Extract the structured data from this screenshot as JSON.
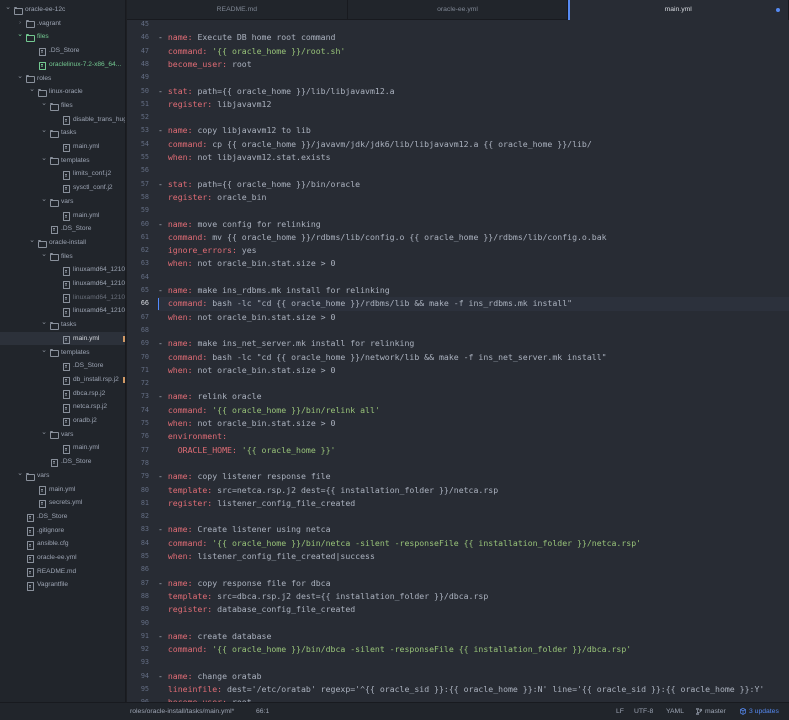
{
  "sidebar": {
    "items": [
      {
        "label": "oracle-ee-12c",
        "kind": "folder",
        "depth": 0,
        "expanded": true
      },
      {
        "label": ".vagrant",
        "kind": "folder",
        "depth": 1,
        "expanded": false
      },
      {
        "label": "files",
        "kind": "folder",
        "depth": 1,
        "expanded": true,
        "status": "added"
      },
      {
        "label": ".DS_Store",
        "kind": "file",
        "depth": 2
      },
      {
        "label": "oraclelinux-7.2-x86_64...",
        "kind": "file",
        "depth": 2,
        "status": "added"
      },
      {
        "label": "roles",
        "kind": "folder",
        "depth": 1,
        "expanded": true
      },
      {
        "label": "linux-oracle",
        "kind": "folder",
        "depth": 2,
        "expanded": true
      },
      {
        "label": "files",
        "kind": "folder",
        "depth": 3,
        "expanded": true
      },
      {
        "label": "disable_trans_hug...",
        "kind": "file",
        "depth": 4
      },
      {
        "label": "tasks",
        "kind": "folder",
        "depth": 3,
        "expanded": true
      },
      {
        "label": "main.yml",
        "kind": "file",
        "depth": 4
      },
      {
        "label": "templates",
        "kind": "folder",
        "depth": 3,
        "expanded": true
      },
      {
        "label": "limits_conf.j2",
        "kind": "file",
        "depth": 4
      },
      {
        "label": "sysctl_conf.j2",
        "kind": "file",
        "depth": 4
      },
      {
        "label": "vars",
        "kind": "folder",
        "depth": 3,
        "expanded": true
      },
      {
        "label": "main.yml",
        "kind": "file",
        "depth": 4
      },
      {
        "label": ".DS_Store",
        "kind": "file",
        "depth": 3
      },
      {
        "label": "oracle-install",
        "kind": "folder",
        "depth": 2,
        "expanded": true
      },
      {
        "label": "files",
        "kind": "folder",
        "depth": 3,
        "expanded": true
      },
      {
        "label": "linuxamd64_1210...",
        "kind": "file",
        "depth": 4
      },
      {
        "label": "linuxamd64_1210...",
        "kind": "file",
        "depth": 4
      },
      {
        "label": "linuxamd64_1210...",
        "kind": "file",
        "depth": 4,
        "status": "ignored"
      },
      {
        "label": "linuxamd64_1210...",
        "kind": "file",
        "depth": 4
      },
      {
        "label": "tasks",
        "kind": "folder",
        "depth": 3,
        "expanded": true
      },
      {
        "label": "main.yml",
        "kind": "file",
        "depth": 4,
        "selected": true,
        "modified": true
      },
      {
        "label": "templates",
        "kind": "folder",
        "depth": 3,
        "expanded": true
      },
      {
        "label": ".DS_Store",
        "kind": "file",
        "depth": 4
      },
      {
        "label": "db_install.rsp.j2",
        "kind": "file",
        "depth": 4,
        "modified": true
      },
      {
        "label": "dbca.rsp.j2",
        "kind": "file",
        "depth": 4
      },
      {
        "label": "netca.rsp.j2",
        "kind": "file",
        "depth": 4
      },
      {
        "label": "oradb.j2",
        "kind": "file",
        "depth": 4
      },
      {
        "label": "vars",
        "kind": "folder",
        "depth": 3,
        "expanded": true
      },
      {
        "label": "main.yml",
        "kind": "file",
        "depth": 4
      },
      {
        "label": ".DS_Store",
        "kind": "file",
        "depth": 3
      },
      {
        "label": "vars",
        "kind": "folder",
        "depth": 1,
        "expanded": true
      },
      {
        "label": "main.yml",
        "kind": "file",
        "depth": 2
      },
      {
        "label": "secrets.yml",
        "kind": "file",
        "depth": 2
      },
      {
        "label": ".DS_Store",
        "kind": "file",
        "depth": 1
      },
      {
        "label": ".gitignore",
        "kind": "file",
        "depth": 1
      },
      {
        "label": "ansible.cfg",
        "kind": "file",
        "depth": 1
      },
      {
        "label": "oracle-ee.yml",
        "kind": "file",
        "depth": 1
      },
      {
        "label": "README.md",
        "kind": "file",
        "depth": 1
      },
      {
        "label": "Vagrantfile",
        "kind": "file",
        "depth": 1
      }
    ]
  },
  "tabs": [
    {
      "label": "README.md",
      "active": false,
      "modified": false
    },
    {
      "label": "oracle-ee.yml",
      "active": false,
      "modified": false
    },
    {
      "label": "main.yml",
      "active": true,
      "modified": true
    }
  ],
  "editor": {
    "first_line_number": 45,
    "cursor_line": 66,
    "lines": [
      [],
      [
        [
          "dash",
          "- "
        ],
        [
          "key",
          "name:"
        ],
        [
          "val",
          " Execute DB home root command"
        ]
      ],
      [
        [
          "dash",
          "  "
        ],
        [
          "key",
          "command:"
        ],
        [
          "str",
          " '{{ oracle_home }}/root.sh'"
        ]
      ],
      [
        [
          "dash",
          "  "
        ],
        [
          "key",
          "become_user:"
        ],
        [
          "val",
          " root"
        ]
      ],
      [],
      [
        [
          "dash",
          "- "
        ],
        [
          "key",
          "stat:"
        ],
        [
          "val",
          " path={{ oracle_home }}/lib/libjavavm12.a"
        ]
      ],
      [
        [
          "dash",
          "  "
        ],
        [
          "key",
          "register:"
        ],
        [
          "val",
          " libjavavm12"
        ]
      ],
      [],
      [
        [
          "dash",
          "- "
        ],
        [
          "key",
          "name:"
        ],
        [
          "val",
          " copy libjavavm12 to lib"
        ]
      ],
      [
        [
          "dash",
          "  "
        ],
        [
          "key",
          "command:"
        ],
        [
          "val",
          " cp {{ oracle_home }}/javavm/jdk/jdk6/lib/libjavavm12.a {{ oracle_home }}/lib/"
        ]
      ],
      [
        [
          "dash",
          "  "
        ],
        [
          "key",
          "when:"
        ],
        [
          "val",
          " not libjavavm12.stat.exists"
        ]
      ],
      [],
      [
        [
          "dash",
          "- "
        ],
        [
          "key",
          "stat:"
        ],
        [
          "val",
          " path={{ oracle_home }}/bin/oracle"
        ]
      ],
      [
        [
          "dash",
          "  "
        ],
        [
          "key",
          "register:"
        ],
        [
          "val",
          " oracle_bin"
        ]
      ],
      [],
      [
        [
          "dash",
          "- "
        ],
        [
          "key",
          "name:"
        ],
        [
          "val",
          " move config for relinking"
        ]
      ],
      [
        [
          "dash",
          "  "
        ],
        [
          "key",
          "command:"
        ],
        [
          "val",
          " mv {{ oracle_home }}/rdbms/lib/config.o {{ oracle_home }}/rdbms/lib/config.o.bak"
        ]
      ],
      [
        [
          "dash",
          "  "
        ],
        [
          "key",
          "ignore_errors:"
        ],
        [
          "val",
          " yes"
        ]
      ],
      [
        [
          "dash",
          "  "
        ],
        [
          "key",
          "when:"
        ],
        [
          "val",
          " not oracle_bin.stat.size > 0"
        ]
      ],
      [],
      [
        [
          "dash",
          "- "
        ],
        [
          "key",
          "name:"
        ],
        [
          "val",
          " make ins_rdbms.mk install for relinking"
        ]
      ],
      [
        [
          "dash",
          "  "
        ],
        [
          "key",
          "command:"
        ],
        [
          "val",
          " bash -lc \"cd {{ oracle_home }}/rdbms/lib && make -f ins_rdbms.mk install\""
        ]
      ],
      [
        [
          "dash",
          "  "
        ],
        [
          "key",
          "when:"
        ],
        [
          "val",
          " not oracle_bin.stat.size > 0"
        ]
      ],
      [],
      [
        [
          "dash",
          "- "
        ],
        [
          "key",
          "name:"
        ],
        [
          "val",
          " make ins_net_server.mk install for relinking"
        ]
      ],
      [
        [
          "dash",
          "  "
        ],
        [
          "key",
          "command:"
        ],
        [
          "val",
          " bash -lc \"cd {{ oracle_home }}/network/lib && make -f ins_net_server.mk install\""
        ]
      ],
      [
        [
          "dash",
          "  "
        ],
        [
          "key",
          "when:"
        ],
        [
          "val",
          " not oracle_bin.stat.size > 0"
        ]
      ],
      [],
      [
        [
          "dash",
          "- "
        ],
        [
          "key",
          "name:"
        ],
        [
          "val",
          " relink oracle"
        ]
      ],
      [
        [
          "dash",
          "  "
        ],
        [
          "key",
          "command:"
        ],
        [
          "str",
          " '{{ oracle_home }}/bin/relink all'"
        ]
      ],
      [
        [
          "dash",
          "  "
        ],
        [
          "key",
          "when:"
        ],
        [
          "val",
          " not oracle_bin.stat.size > 0"
        ]
      ],
      [
        [
          "dash",
          "  "
        ],
        [
          "key",
          "environment:"
        ]
      ],
      [
        [
          "dash",
          "    "
        ],
        [
          "key",
          "ORACLE_HOME:"
        ],
        [
          "str",
          " '{{ oracle_home }}'"
        ]
      ],
      [],
      [
        [
          "dash",
          "- "
        ],
        [
          "key",
          "name:"
        ],
        [
          "val",
          " copy listener response file"
        ]
      ],
      [
        [
          "dash",
          "  "
        ],
        [
          "key",
          "template:"
        ],
        [
          "val",
          " src=netca.rsp.j2 dest={{ installation_folder }}/netca.rsp"
        ]
      ],
      [
        [
          "dash",
          "  "
        ],
        [
          "key",
          "register:"
        ],
        [
          "val",
          " listener_config_file_created"
        ]
      ],
      [],
      [
        [
          "dash",
          "- "
        ],
        [
          "key",
          "name:"
        ],
        [
          "val",
          " Create listener using netca"
        ]
      ],
      [
        [
          "dash",
          "  "
        ],
        [
          "key",
          "command:"
        ],
        [
          "str",
          " '{{ oracle_home }}/bin/netca -silent -responseFile {{ installation_folder }}/netca.rsp'"
        ]
      ],
      [
        [
          "dash",
          "  "
        ],
        [
          "key",
          "when:"
        ],
        [
          "val",
          " listener_config_file_created|success"
        ]
      ],
      [],
      [
        [
          "dash",
          "- "
        ],
        [
          "key",
          "name:"
        ],
        [
          "val",
          " copy response file for dbca"
        ]
      ],
      [
        [
          "dash",
          "  "
        ],
        [
          "key",
          "template:"
        ],
        [
          "val",
          " src=dbca.rsp.j2 dest={{ installation_folder }}/dbca.rsp"
        ]
      ],
      [
        [
          "dash",
          "  "
        ],
        [
          "key",
          "register:"
        ],
        [
          "val",
          " database_config_file_created"
        ]
      ],
      [],
      [
        [
          "dash",
          "- "
        ],
        [
          "key",
          "name:"
        ],
        [
          "val",
          " create database"
        ]
      ],
      [
        [
          "dash",
          "  "
        ],
        [
          "key",
          "command:"
        ],
        [
          "str",
          " '{{ oracle_home }}/bin/dbca -silent -responseFile {{ installation_folder }}/dbca.rsp'"
        ]
      ],
      [],
      [
        [
          "dash",
          "- "
        ],
        [
          "key",
          "name:"
        ],
        [
          "val",
          " change oratab"
        ]
      ],
      [
        [
          "dash",
          "  "
        ],
        [
          "key",
          "lineinfile:"
        ],
        [
          "val",
          " dest='/etc/oratab' regexp='^{{ oracle_sid }}:{{ oracle_home }}:N' line='{{ oracle_sid }}:{{ oracle_home }}:Y'"
        ]
      ],
      [
        [
          "dash",
          "  "
        ],
        [
          "key",
          "become_user:"
        ],
        [
          "val",
          " root"
        ]
      ]
    ]
  },
  "statusbar": {
    "file_path": "roles/oracle-install/tasks/main.yml*",
    "cursor_position": "66:1",
    "line_ending": "LF",
    "encoding": "UTF-8",
    "grammar": "YAML",
    "branch": "master",
    "updates": "3 updates"
  },
  "colors": {
    "accent": "#568af2",
    "added": "#73c991",
    "yaml_key": "#e06c75",
    "yaml_string": "#98c379",
    "text": "#abb2bf"
  }
}
